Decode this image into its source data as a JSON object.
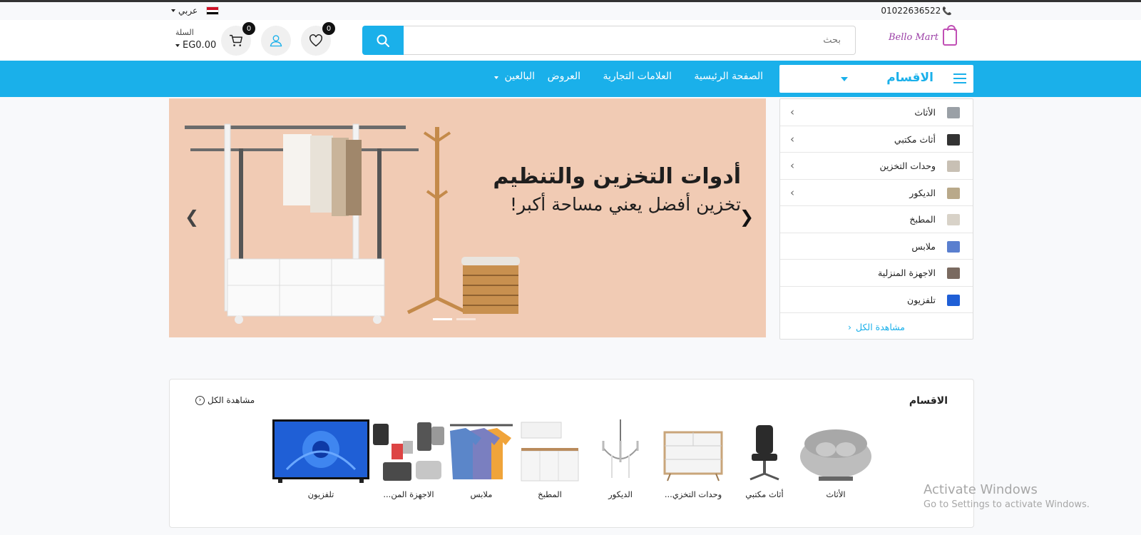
{
  "topbar": {
    "phone": "01022636522",
    "language": "عربي"
  },
  "header": {
    "logo_text": "Bello Mart",
    "search_placeholder": "بحث",
    "wishlist_count": "0",
    "cart_count": "0",
    "cart_label": "السلة",
    "cart_amount": "EG0.00"
  },
  "nav": {
    "categories_label": "الاقسام",
    "links": [
      "الصفحة الرئيسية",
      "العلامات التجارية",
      "العروض",
      "البالعين"
    ]
  },
  "banner": {
    "title": "أدوات التخزين والتنظيم",
    "subtitle": "تخزين أفضل يعني مساحة أكبر!",
    "slides": 2,
    "active_slide": 1
  },
  "sidebar": {
    "items": [
      {
        "label": "الأثاث",
        "has_submenu": true,
        "color": "#9aa0a6"
      },
      {
        "label": "أثاث مكتبي",
        "has_submenu": true,
        "color": "#333333"
      },
      {
        "label": "وحدات التخزين",
        "has_submenu": true,
        "color": "#c8c0b4"
      },
      {
        "label": "الديكور",
        "has_submenu": true,
        "color": "#b9a98a"
      },
      {
        "label": "المطبخ",
        "has_submenu": false,
        "color": "#d8d2c8"
      },
      {
        "label": "ملابس",
        "has_submenu": false,
        "color": "#5a7fcf"
      },
      {
        "label": "الاجهزة المنزلية",
        "has_submenu": false,
        "color": "#7a6a60"
      },
      {
        "label": "تلفزيون",
        "has_submenu": false,
        "color": "#1f5fd6"
      }
    ],
    "view_all": "مشاهدة الكل"
  },
  "categories_section": {
    "title": "الاقسام",
    "view_all": "مشاهدة الكل",
    "items": [
      {
        "label": "الأثاث",
        "icon": "sofa-chair-image"
      },
      {
        "label": "أثاث مكتبي",
        "icon": "office-chair-image"
      },
      {
        "label": "وحدات التخزي...",
        "icon": "dresser-image"
      },
      {
        "label": "الديكور",
        "icon": "chandelier-image"
      },
      {
        "label": "المطبخ",
        "icon": "kitchen-image"
      },
      {
        "label": "ملابس",
        "icon": "clothes-image"
      },
      {
        "label": "الاجهزة المن...",
        "icon": "appliances-image"
      },
      {
        "label": "تلفزيون",
        "icon": "tv-image"
      }
    ]
  },
  "watermark": {
    "line1": "Activate Windows",
    "line2": "Go to Settings to activate Windows."
  },
  "colors": {
    "primary": "#1ab0ea",
    "banner_bg": "#f1cbb4",
    "brand": "#9b3fa6"
  }
}
